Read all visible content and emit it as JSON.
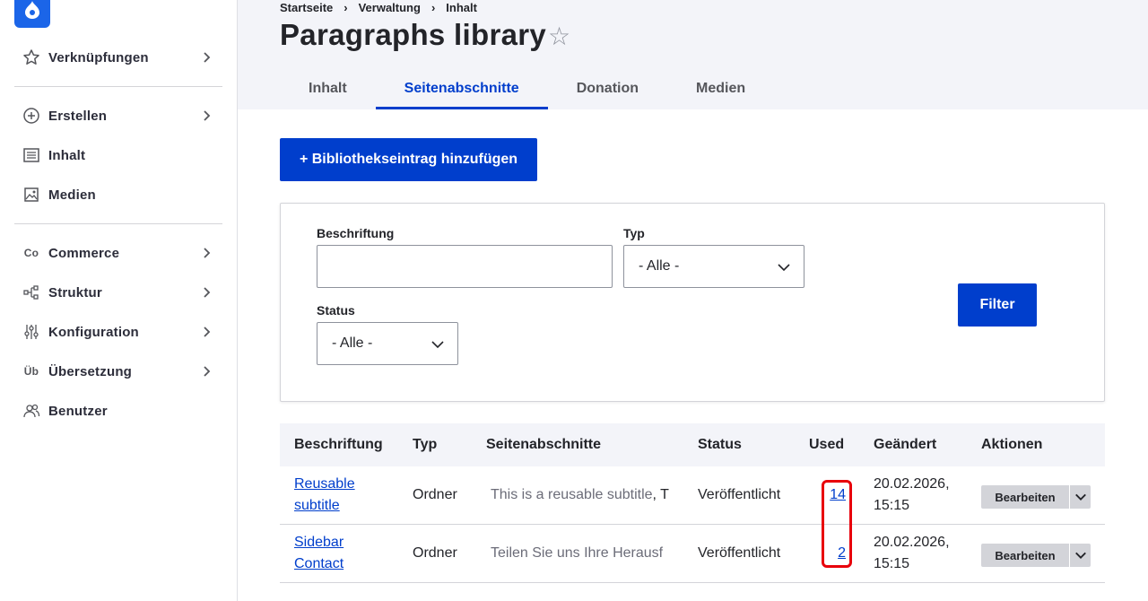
{
  "sidebar": {
    "items": [
      {
        "label": "Verknüpfungen",
        "icon": "star-icon",
        "has_children": true
      },
      {
        "label": "Erstellen",
        "icon": "plus-circle-icon",
        "has_children": true
      },
      {
        "label": "Inhalt",
        "icon": "document-list-icon",
        "has_children": false
      },
      {
        "label": "Medien",
        "icon": "image-icon",
        "has_children": false
      },
      {
        "label": "Commerce",
        "icon": "commerce-icon",
        "icon_text": "Co",
        "has_children": true
      },
      {
        "label": "Struktur",
        "icon": "structure-icon",
        "has_children": true
      },
      {
        "label": "Konfiguration",
        "icon": "sliders-icon",
        "has_children": true
      },
      {
        "label": "Übersetzung",
        "icon": "translation-icon",
        "icon_text": "Üb",
        "has_children": true
      },
      {
        "label": "Benutzer",
        "icon": "users-icon",
        "has_children": false
      }
    ]
  },
  "header": {
    "breadcrumb": [
      "Startseite",
      "Verwaltung",
      "Inhalt"
    ],
    "title": "Paragraphs library",
    "tabs": [
      {
        "label": "Inhalt",
        "active": false
      },
      {
        "label": "Seitenabschnitte",
        "active": true
      },
      {
        "label": "Donation",
        "active": false
      },
      {
        "label": "Medien",
        "active": false
      }
    ]
  },
  "actions": {
    "add_label": "+ Bibliothekseintrag hinzufügen"
  },
  "filter": {
    "label_field": {
      "label": "Beschriftung",
      "value": ""
    },
    "type_field": {
      "label": "Typ",
      "value": "- Alle -"
    },
    "status_field": {
      "label": "Status",
      "value": "- Alle -"
    },
    "submit_label": "Filter"
  },
  "table": {
    "headers": [
      "Beschriftung",
      "Typ",
      "Seitenabschnitte",
      "Status",
      "Used",
      "Geändert",
      "Aktionen"
    ],
    "rows": [
      {
        "label_line1": "Reusable",
        "label_line2": "subtitle",
        "type": "Ordner",
        "paragraphs_a": "This is a reusable subtitle",
        "paragraphs_b": ", T",
        "status": "Veröffentlicht",
        "used": "14",
        "changed_date": "20.02.2026,",
        "changed_time": "15:15",
        "action": "Bearbeiten"
      },
      {
        "label_line1": "Sidebar",
        "label_line2": "Contact",
        "type": "Ordner",
        "paragraphs_a": "Teilen Sie uns Ihre Herausf",
        "paragraphs_b": "",
        "status": "Veröffentlicht",
        "used": "2",
        "changed_date": "20.02.2026,",
        "changed_time": "15:15",
        "action": "Bearbeiten"
      }
    ]
  },
  "colors": {
    "accent": "#003ecc",
    "highlight": "#e8000b",
    "header_bg": "#f3f4f9",
    "logo": "#1b65e8"
  }
}
